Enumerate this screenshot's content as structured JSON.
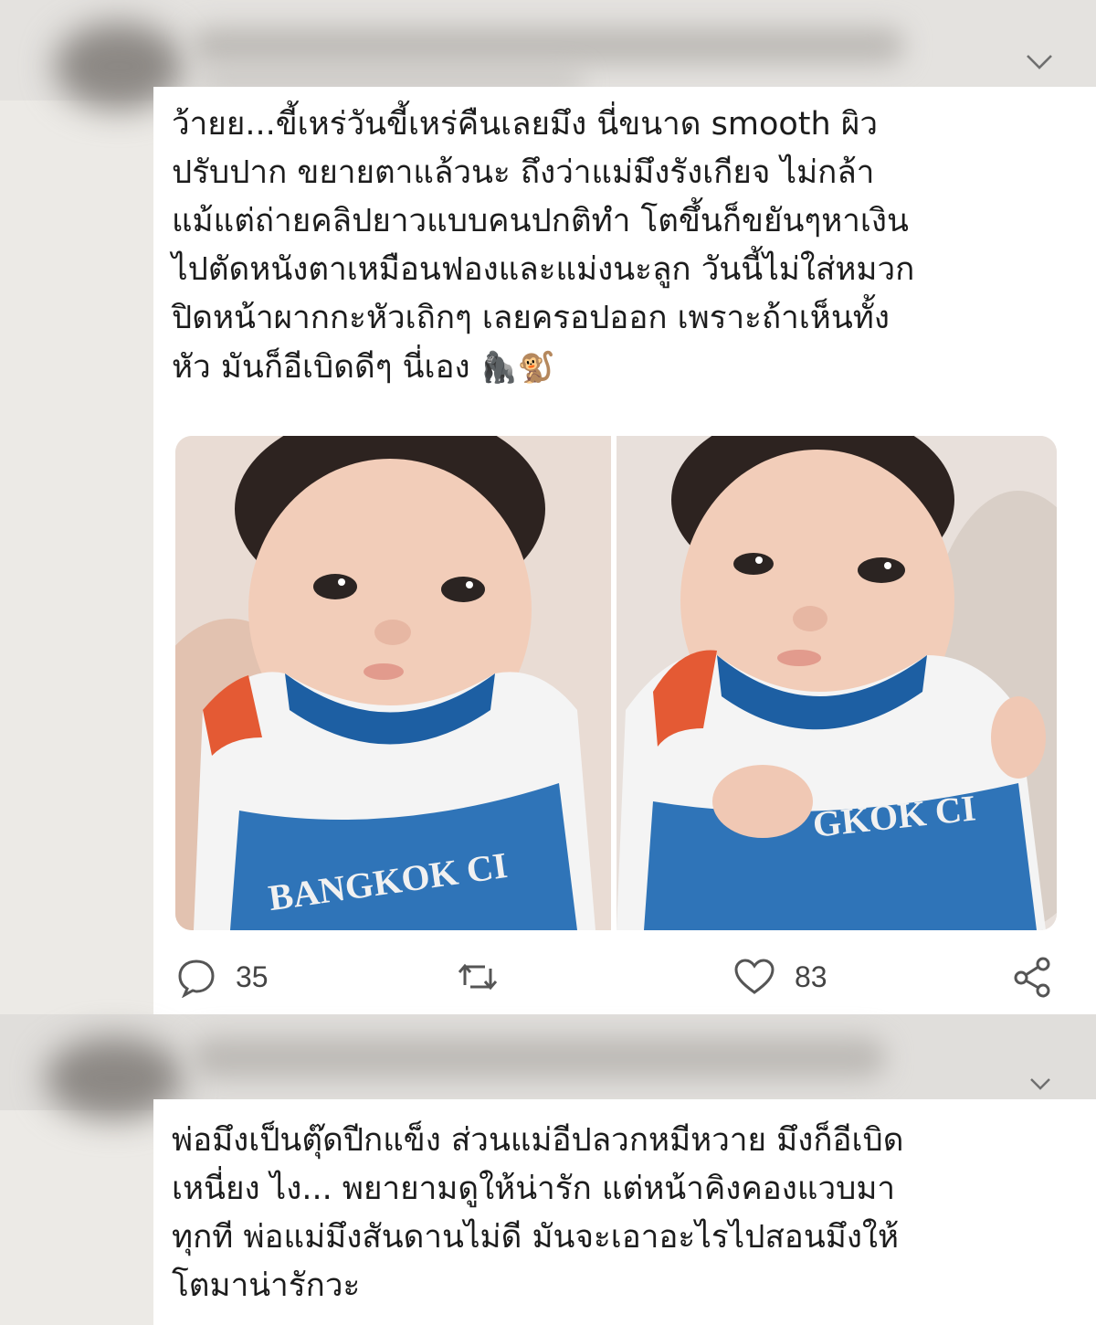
{
  "tweet1": {
    "text": "ว้ายย...ขี้เหร่วันขี้เหร่คืนเลยมึง นี่ขนาด smooth ผิว\nปรับปาก ขยายตาแล้วนะ ถึงว่าแม่มึงรังเกียจ ไม่กล้า\nแม้แต่ถ่ายคลิปยาวแบบคนปกติทำ โตขึ้นก็ขยันๆหาเงิน\nไปตัดหนังตาเหมือนฟองและแม่งนะลูก วันนี้ไม่ใส่หมวก\nปิดหน้าผากกะหัวเถิกๆ เลยครอปออก เพราะถ้าเห็นทั้ง\nหัว มันก็อีเบิดดีๆ นี่เอง",
    "emoji_1": "🦍",
    "emoji_2": "🐒",
    "photo_left_shirt_text": "BANGKOK CI",
    "photo_right_shirt_text": "GKOK CI",
    "reply_count": "35",
    "like_count": "83"
  },
  "tweet2": {
    "text": "พ่อมึงเป็นตุ๊ดปีกแข็ง ส่วนแม่อีปลวกหมีหวาย มึงก็อีเบิด\nเหนี่ยง ไง... พยายามดูให้น่ารัก แต่หน้าคิงคองแวบมา\nทุกที พ่อแม่มึงสันดานไม่ดี มันจะเอาอะไรไปสอนมึงให้\nโตมาน่ารักวะ"
  },
  "icons": {
    "more": "chevron-down-icon",
    "reply": "reply-bubble-icon",
    "retweet": "retweet-icon",
    "like": "heart-icon",
    "share": "share-icon"
  },
  "colors": {
    "background": "#eceae6",
    "card": "#ffffff",
    "text": "#1c1c1c",
    "icon": "#555555"
  }
}
